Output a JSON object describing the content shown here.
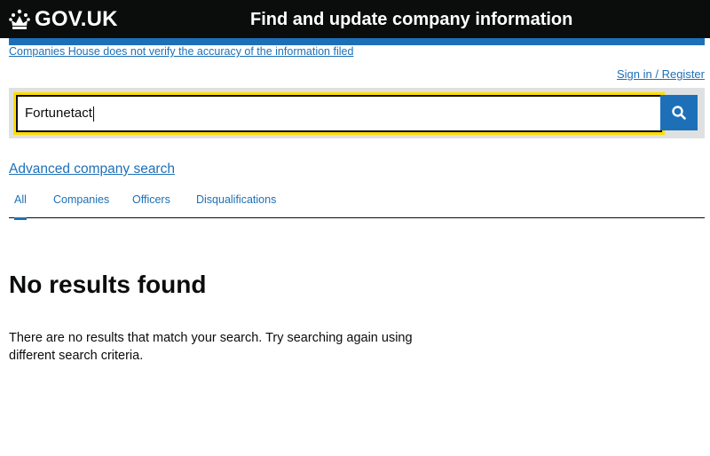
{
  "header": {
    "logo_text": "GOV.UK",
    "service_name": "Find and update company information"
  },
  "disclaimer": "Companies House does not verify the accuracy of the information filed",
  "signin_label": "Sign in / Register",
  "search": {
    "value": "Fortunetact",
    "button_icon": "search-icon"
  },
  "advanced_search_label": "Advanced company search",
  "tabs": [
    {
      "label": "All",
      "active": true
    },
    {
      "label": "Companies",
      "active": false
    },
    {
      "label": "Officers",
      "active": false
    },
    {
      "label": "Disqualifications",
      "active": false
    }
  ],
  "results": {
    "heading": "No results found",
    "message": "There are no results that match your search. Try searching again using different search criteria."
  },
  "colors": {
    "header_bg": "#0b0c0c",
    "link_blue": "#1d70b8",
    "focus_yellow": "#ffdd00",
    "panel_grey": "#dee0e2"
  }
}
